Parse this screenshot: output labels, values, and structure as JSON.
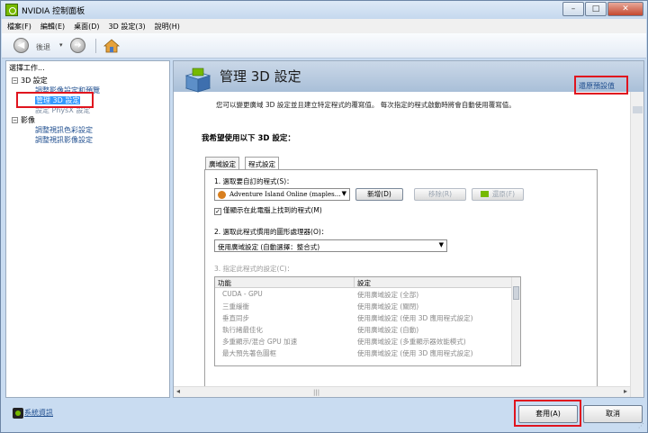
{
  "window": {
    "title": "NVIDIA 控制面板",
    "controls": [
      "–",
      "□",
      "✕"
    ]
  },
  "menu": [
    "檔案(F)",
    "編輯(E)",
    "桌面(D)",
    "3D 設定(3)",
    "說明(H)"
  ],
  "toolbar": {
    "back_label": "後退",
    "dropdown": "▾",
    "forward": "➜",
    "back": "◀"
  },
  "sidebar": {
    "title": "選擇工作...",
    "tree": [
      {
        "label": "3D 設定",
        "toggle": "−"
      },
      {
        "label": "調整影像設定和預覽",
        "state": "normal"
      },
      {
        "label": "管理 3D 設定",
        "state": "selected"
      },
      {
        "label": "設定 PhysX 設定",
        "state": "disabled"
      },
      {
        "label": "影像",
        "toggle": "−"
      },
      {
        "label": "調整視訊色彩設定",
        "state": "normal"
      },
      {
        "label": "調整視訊影像設定",
        "state": "normal"
      }
    ],
    "system_info": "系統資訊"
  },
  "main": {
    "page_title": "管理 3D 設定",
    "restore_defaults": "還原預設值",
    "description": "您可以變更廣域 3D 設定並且建立特定程式的覆寫值。 每次指定的程式啟動時將會自動使用覆寫值。",
    "section_title": "我希望使用以下 3D 設定：",
    "tabs": [
      "廣域設定",
      "程式設定"
    ],
    "step1_label": "1. 選取要自訂的程式(S)：",
    "program_selected": "Adventure Island Online (maples...",
    "add_button": "新增(D)",
    "remove_button": "移除(R)",
    "restore_button": "還原(F)",
    "only_show_found": "僅顯示在此電腦上找到的程式(M)",
    "only_show_found_checked": "✓",
    "step2_label": "2. 選取此程式慣用的圖形處理器(O)：",
    "gpu_selected": "使用廣域設定 (自動選擇：整合式)",
    "step3_label": "3. 指定此程式的設定(C)：",
    "table_headers": [
      "功能",
      "設定"
    ],
    "table_rows": [
      [
        "CUDA - GPU",
        "使用廣域設定 (全部)"
      ],
      [
        "三重緩衝",
        "使用廣域設定 (關閉)"
      ],
      [
        "垂直同步",
        "使用廣域設定 (使用 3D 應用程式設定)"
      ],
      [
        "執行緒最佳化",
        "使用廣域設定 (自動)"
      ],
      [
        "多重顯示/混合 GPU 加速",
        "使用廣域設定 (多重顯示器效能模式)"
      ],
      [
        "最大預先著色圖框",
        "使用廣域設定 (使用 3D 應用程式設定)"
      ]
    ],
    "scroll_grip": "|||"
  },
  "footer": {
    "apply": "套用(A)",
    "cancel": "取消"
  }
}
